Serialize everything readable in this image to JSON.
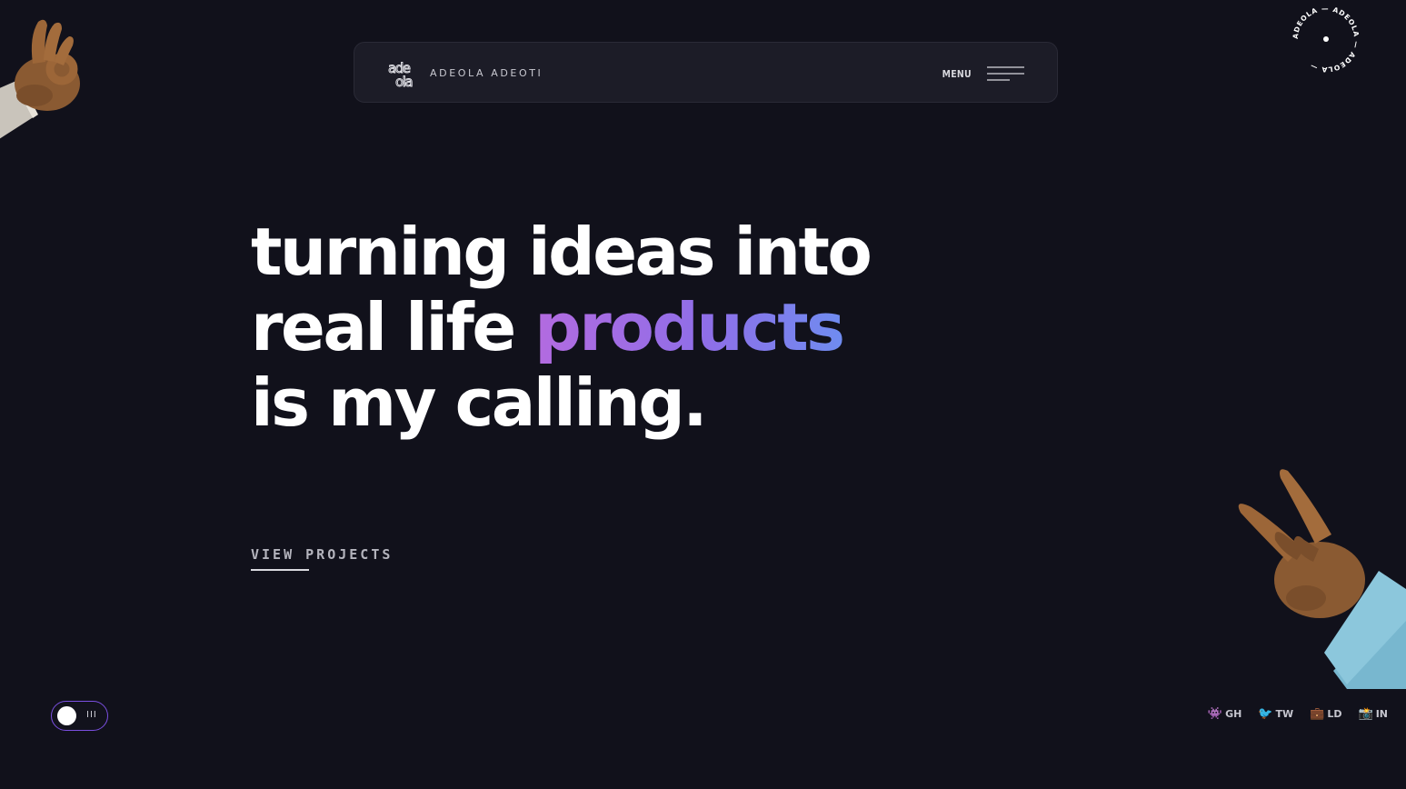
{
  "header": {
    "brand_name": "ADEOLA ADEOTI",
    "logo_top": "ade",
    "logo_bottom": "ola",
    "menu_label": "MENU"
  },
  "badge": {
    "text": "ADEOLA — ADEOLA — ADEOLA — "
  },
  "hero": {
    "line1": "turning ideas into",
    "line2_prefix": "real life ",
    "line2_accent": "products",
    "line3": "is my calling."
  },
  "cta": {
    "label": "VIEW PROJECTS"
  },
  "theme_toggle": {
    "mark": "III"
  },
  "socials": [
    {
      "icon": "👾",
      "label": "GH"
    },
    {
      "icon": "🐦",
      "label": "TW"
    },
    {
      "icon": "💼",
      "label": "LD"
    },
    {
      "icon": "📸",
      "label": "IN"
    }
  ],
  "colors": {
    "background": "#11111b",
    "header_bg": "#1c1c27",
    "accent_gradient_start": "#b36be0",
    "accent_gradient_end": "#6f8cf0",
    "toggle_border": "#7a4fe0"
  }
}
